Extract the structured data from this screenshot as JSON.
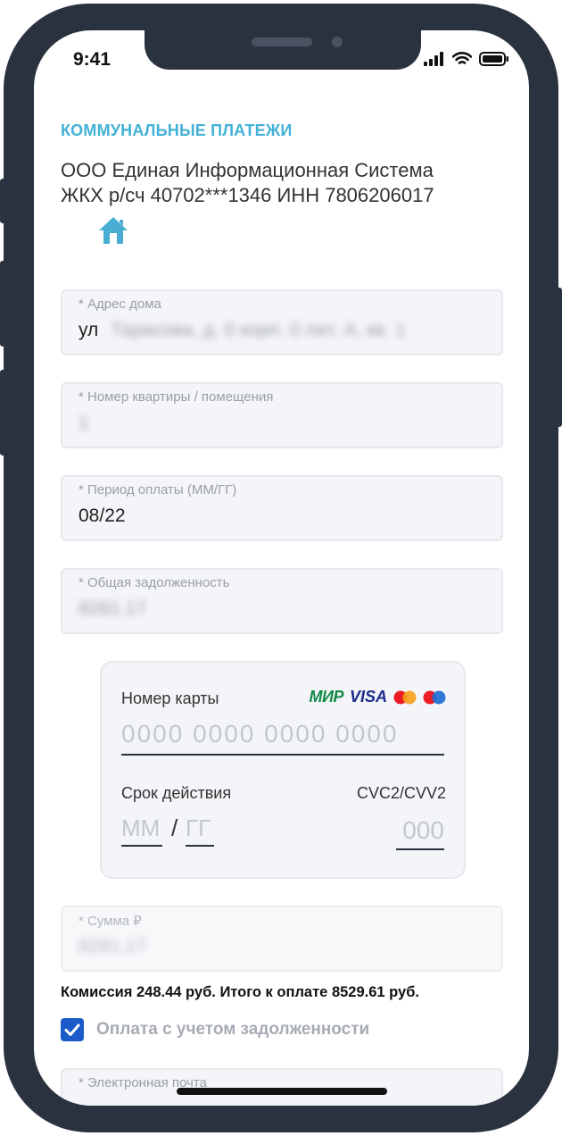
{
  "status_bar": {
    "time": "9:41"
  },
  "header": {
    "section_title": "КОММУНАЛЬНЫЕ ПЛАТЕЖИ",
    "org_line1": "ООО Единая Информационная Система",
    "org_line2": "ЖКХ р/сч 40702***1346 ИНН 7806206017",
    "icon": "home-icon"
  },
  "fields": {
    "address": {
      "label": "* Адрес дома",
      "prefix": "ул",
      "value": "Тарасова, д. 0 корп. 0 лит. А, кв. 1"
    },
    "apartment": {
      "label": "* Номер квартиры / помещения",
      "value": "1"
    },
    "period": {
      "label": "* Период оплаты (ММ/ГГ)",
      "value": "08/22"
    },
    "debt": {
      "label": "* Общая задолженность",
      "value": "8281.17"
    },
    "sum": {
      "label": "* Сумма ₽",
      "value": "8281.17"
    },
    "email": {
      "label": "* Электронная почта"
    }
  },
  "card": {
    "number_label": "Номер карты",
    "number_placeholder": "0000 0000 0000 0000",
    "expiry_label": "Срок действия",
    "month_placeholder": "ММ",
    "separator": "/",
    "year_placeholder": "ГГ",
    "cvc_label": "CVC2/CVV2",
    "cvc_placeholder": "000",
    "logos": {
      "mir": "МИР",
      "visa": "VISA"
    }
  },
  "commission_text": "Комиссия 248.44 руб. Итого к оплате 8529.61 руб.",
  "debt_checkbox": {
    "label": "Оплата с учетом задолженности",
    "checked": true
  },
  "colors": {
    "accent": "#42b1d6",
    "checkbox": "#1a5ac9",
    "frame": "#2b323f",
    "field_bg": "#f4f5f8"
  }
}
